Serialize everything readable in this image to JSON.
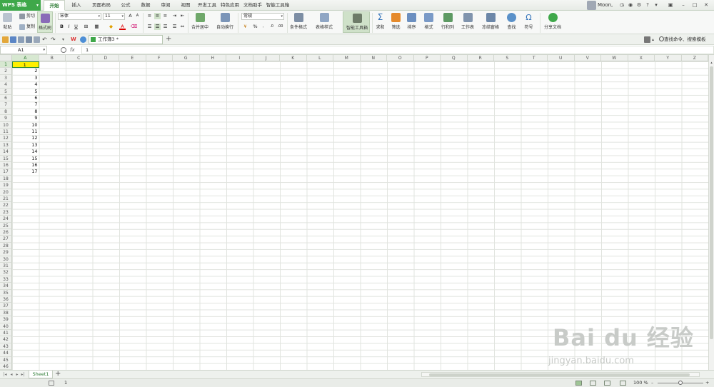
{
  "app": {
    "name": "WPS 表格",
    "user_name": "Moon,",
    "brand_color": "#3fa84a"
  },
  "menu_tabs": [
    {
      "label": "开始",
      "active": true
    },
    {
      "label": "插入"
    },
    {
      "label": "页面布局"
    },
    {
      "label": "公式"
    },
    {
      "label": "数据"
    },
    {
      "label": "审阅"
    },
    {
      "label": "视图"
    },
    {
      "label": "开发工具"
    },
    {
      "label": "特色应用"
    },
    {
      "label": "文档助手"
    },
    {
      "label": "智能工具箱"
    }
  ],
  "ribbon": {
    "paste": "粘贴",
    "cut": "剪切",
    "copy": "复制",
    "format_painter": "格式刷",
    "font_name": "宋体",
    "font_size": "11",
    "bold": "B",
    "italic": "I",
    "underline": "U",
    "merge_center": "合并居中",
    "wrap_text": "自动换行",
    "number_format": "常规",
    "percent": "%",
    "thousands": "000",
    "conditional_format": "条件格式",
    "table_style": "表格样式",
    "smart_toolbox": "智能工具箱",
    "sum": "求和",
    "filter": "筛选",
    "sort": "排序",
    "format": "格式",
    "row_col": "行和列",
    "worksheet": "工作表",
    "freeze_panes": "冻结窗格",
    "find": "查找",
    "symbol": "符号",
    "share_doc": "分享文档"
  },
  "doc_tab": {
    "title": "工作簿3 *"
  },
  "search_command": "查找命令、搜索模板",
  "formula_bar": {
    "name_box": "A1",
    "fx_label": "fx",
    "value": "1"
  },
  "columns": [
    "A",
    "B",
    "C",
    "D",
    "E",
    "F",
    "G",
    "H",
    "I",
    "J",
    "K",
    "L",
    "M",
    "N",
    "O",
    "P",
    "Q",
    "R",
    "S",
    "T",
    "U",
    "V",
    "W",
    "X",
    "Y",
    "Z"
  ],
  "row_count": 46,
  "column_a_values": [
    "1",
    "2",
    "3",
    "4",
    "5",
    "6",
    "7",
    "8",
    "9",
    "10",
    "11",
    "12",
    "13",
    "14",
    "15",
    "16",
    "17"
  ],
  "selected_cell": "A1",
  "sheet_tab": "Sheet1",
  "status": {
    "value": "1",
    "zoom": "100 %"
  },
  "watermark": {
    "brand": "Bai  du 经验",
    "url": "jingyan.baidu.com"
  }
}
